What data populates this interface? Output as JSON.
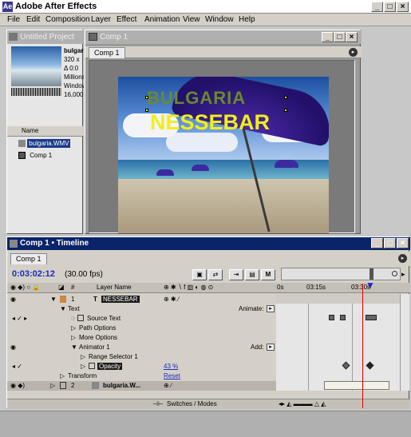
{
  "app": {
    "title": "Adobe After Effects",
    "logo": "Ae"
  },
  "menu": [
    "File",
    "Edit",
    "Composition",
    "Layer",
    "Effect",
    "Animation",
    "View",
    "Window",
    "Help"
  ],
  "project": {
    "title": "Untitled Project",
    "info_lines": [
      "bulgaria",
      "320 x",
      "Δ 0:0",
      "Millions",
      "Windows",
      "16,000"
    ],
    "col_name": "Name",
    "items": [
      "bulgaria.WMV",
      "Comp 1"
    ]
  },
  "comp": {
    "title": "Comp 1",
    "tab": "Comp 1",
    "overlay_line1": "BULGARIA",
    "overlay_line2": "NESSEBAR"
  },
  "timeline": {
    "title": "Comp 1 • Timeline",
    "tab": "Comp 1",
    "timecode": "0:03:02:12",
    "fps": "(30.00 fps)",
    "col_layer_name": "Layer Name",
    "col_hash": "#",
    "ruler": [
      "0s",
      "03:15s",
      "03:30s"
    ],
    "animate_label": "Animate:",
    "add_label": "Add:",
    "rows": [
      {
        "num": "1",
        "name": "NESSEBAR"
      },
      {
        "label": "Text"
      },
      {
        "label": "Source Text"
      },
      {
        "label": "Path Options"
      },
      {
        "label": "More Options"
      },
      {
        "label": "Animator 1"
      },
      {
        "label": "Range Selector 1"
      },
      {
        "label": "Opacity",
        "value": "43 %"
      },
      {
        "label": "Transform",
        "value": "Reset"
      },
      {
        "num": "2",
        "name": "bulgaria.W..."
      }
    ],
    "footer": "Switches / Modes"
  }
}
